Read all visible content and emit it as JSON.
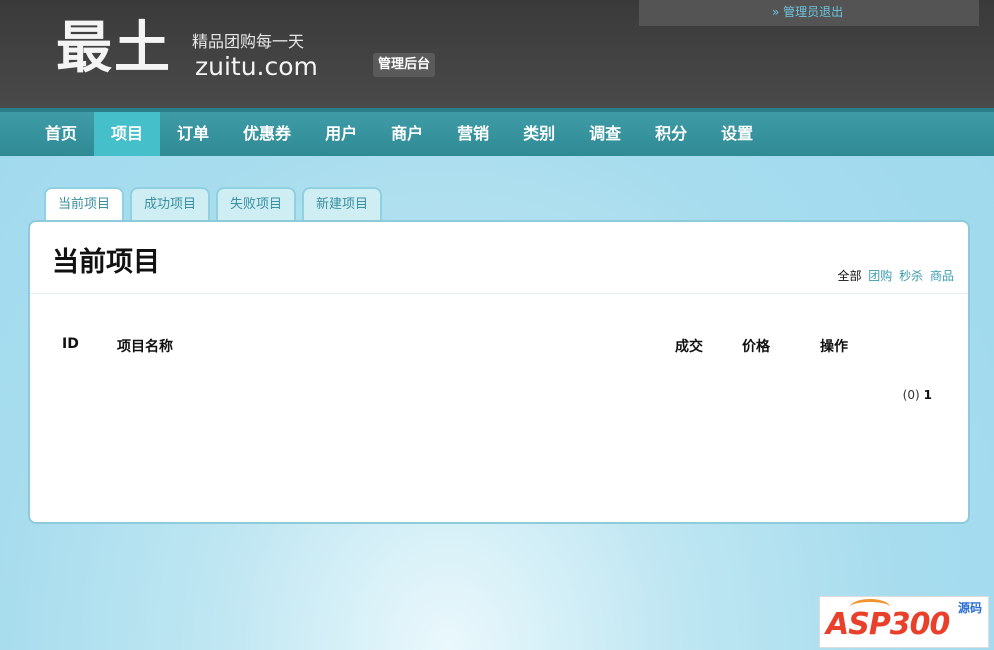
{
  "header": {
    "logo_main": "最土",
    "slogan": "精品团购每一天",
    "domain": "zuitu.com",
    "admin_badge": "管理后台",
    "logout": "» 管理员退出"
  },
  "nav": {
    "items": [
      "首页",
      "项目",
      "订单",
      "优惠券",
      "用户",
      "商户",
      "营销",
      "类别",
      "调查",
      "积分",
      "设置"
    ],
    "active": "项目"
  },
  "tabs": [
    "当前项目",
    "成功项目",
    "失败项目",
    "新建项目"
  ],
  "panel": {
    "title": "当前项目",
    "filters": {
      "all": "全部",
      "groupbuy": "团购",
      "seckill": "秒杀",
      "goods": "商品"
    },
    "columns": {
      "id": "ID",
      "name": "项目名称",
      "deals": "成交",
      "price": "价格",
      "actions": "操作"
    },
    "pager": {
      "count": "(0)",
      "page": "1"
    }
  },
  "watermark": {
    "text": "ASP300",
    "side": "源码"
  },
  "colors": {
    "header_bg": "#3a3a3a",
    "nav_bg": "#3a969f",
    "nav_active": "#45c0ca",
    "page_bg": "#a6dcee",
    "link": "#3a9cb0"
  }
}
